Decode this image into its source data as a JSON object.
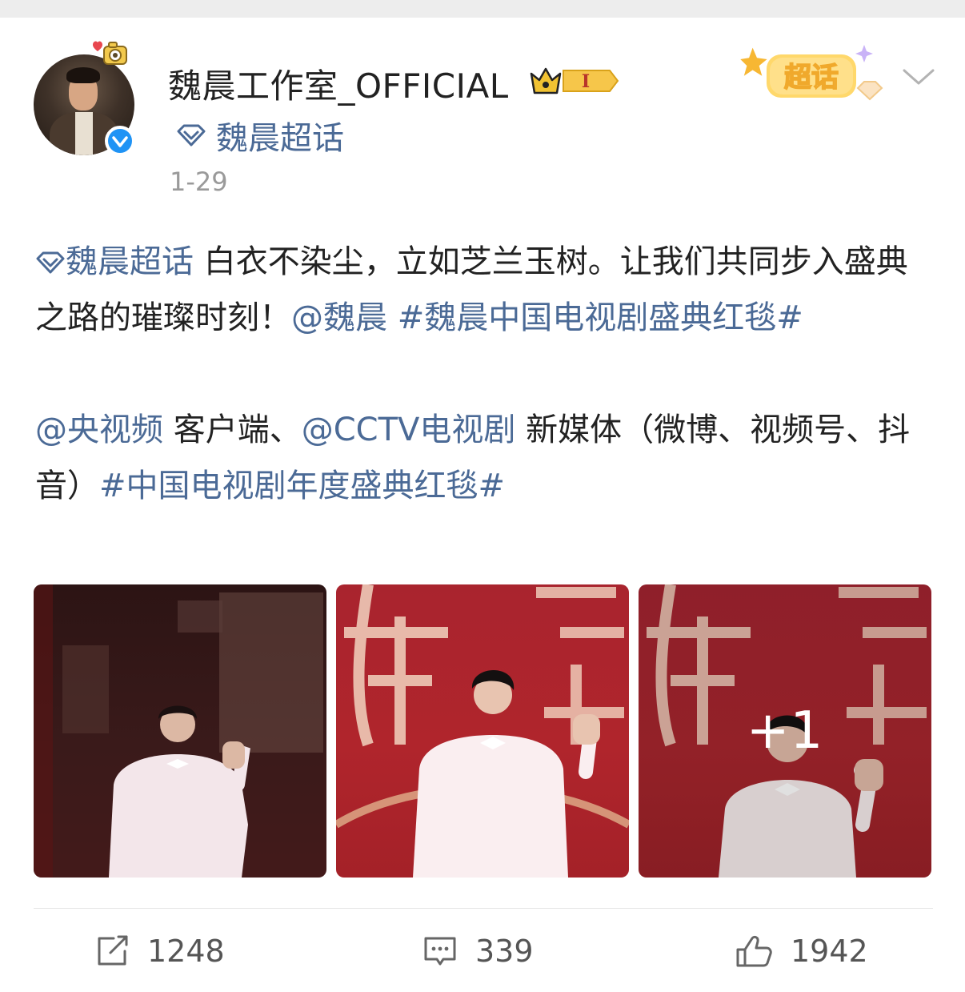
{
  "post": {
    "username": "魏晨工作室_OFFICIAL",
    "level_badge": "I",
    "supertopic": "魏晨超话",
    "timestamp": "1-29",
    "badge_label": "超话",
    "text": {
      "seg1_topic": "魏晨超话",
      "seg2": " 白衣不染尘，立如芝兰玉树。让我们共同步入盛典之路的璀璨时刻！",
      "seg3_mention": "@魏晨",
      "seg4_space": " ",
      "seg5_hashtag": "#魏晨中国电视剧盛典红毯#",
      "seg6_mention": "@央视频",
      "seg7": " 客户端、",
      "seg8_mention": "@CCTV电视剧",
      "seg9": " 新媒体（微博、视频号、抖音）",
      "seg10_hashtag": "#中国电视剧年度盛典红毯#"
    },
    "more_photos_label": "+1"
  },
  "actions": {
    "repost_count": "1248",
    "comment_count": "339",
    "like_count": "1942"
  },
  "colors": {
    "link": "#4b6a96",
    "verified": "#1f93f5",
    "text": "#222222",
    "muted": "#9a9a9a"
  },
  "icons": [
    "camera-deco-icon",
    "verified-icon",
    "crown-level-icon",
    "diamond-topic-icon",
    "chaohua-badge-icon",
    "chevron-down-icon",
    "repost-icon",
    "comment-icon",
    "like-icon"
  ]
}
